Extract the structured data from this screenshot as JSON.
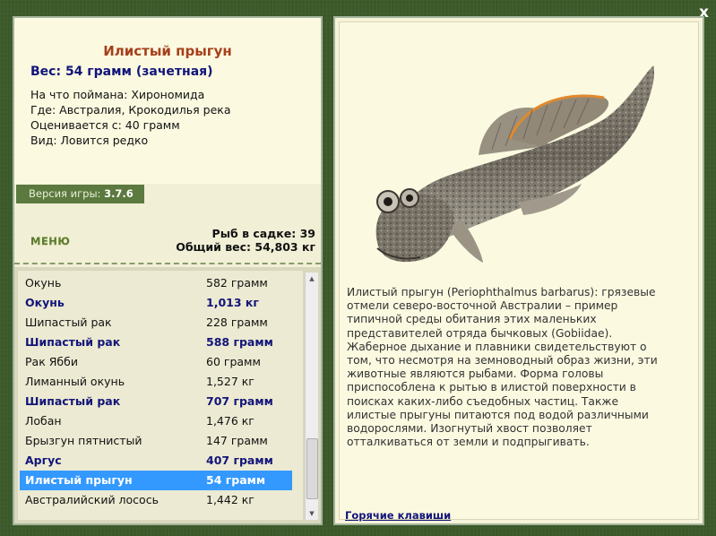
{
  "window": {
    "close_label": "x"
  },
  "fish": {
    "name": "Илистый прыгун",
    "weight_line": "Вес: 54 грамм (зачетная)",
    "info": [
      "На что поймана: Хирономида",
      "Где: Австралия, Крокодилья река",
      "Оценивается с: 40 грамм",
      "Вид: Ловится редко"
    ]
  },
  "version": {
    "label": "Версия игры:",
    "value": "3.7.6"
  },
  "menu_label": "МЕНЮ",
  "stats": {
    "fish_count": "Рыб в садке: 39",
    "total_weight": "Общий вес: 54,803 кг"
  },
  "catch_list": [
    {
      "name": "Окунь",
      "weight": "582 грамм",
      "bold": false,
      "selected": false
    },
    {
      "name": "Окунь",
      "weight": "1,013 кг",
      "bold": true,
      "selected": false
    },
    {
      "name": "Шипастый рак",
      "weight": "228 грамм",
      "bold": false,
      "selected": false
    },
    {
      "name": "Шипастый рак",
      "weight": "588 грамм",
      "bold": true,
      "selected": false
    },
    {
      "name": "Рак Ябби",
      "weight": "60 грамм",
      "bold": false,
      "selected": false
    },
    {
      "name": "Лиманный окунь",
      "weight": "1,527 кг",
      "bold": false,
      "selected": false
    },
    {
      "name": "Шипастый рак",
      "weight": "707 грамм",
      "bold": true,
      "selected": false
    },
    {
      "name": "Лобан",
      "weight": "1,476 кг",
      "bold": false,
      "selected": false
    },
    {
      "name": "Брызгун пятнистый",
      "weight": "147 грамм",
      "bold": false,
      "selected": false
    },
    {
      "name": "Аргус",
      "weight": "407 грамм",
      "bold": true,
      "selected": false
    },
    {
      "name": "Илистый прыгун",
      "weight": "54 грамм",
      "bold": true,
      "selected": true
    },
    {
      "name": "Австралийский лосось",
      "weight": "1,442 кг",
      "bold": false,
      "selected": false
    }
  ],
  "description": "Илистый прыгун (Periophthalmus barbarus): грязевые отмели северо-восточной Австралии – пример типичной среды обитания этих маленьких представителей отряда бычковых (Gobiidae). Жаберное дыхание и плавники свидетельствуют о том, что несмотря на земноводный образ жизни, эти животные являются рыбами. Форма головы приспособлена к рытью в илистой поверхности в поисках каких-либо съедобных частиц. Также илистые прыгуны питаются под водой различными водорослями. Изогнутый хвост позволяет отталкиваться от земли и подпрыгивать.",
  "hotkeys_label": "Горячие клавиши",
  "colors": {
    "frame_green": "#3c5a2a",
    "title_brown": "#a6401b",
    "highlight_blue": "#3399ff",
    "bold_navy": "#131579"
  }
}
